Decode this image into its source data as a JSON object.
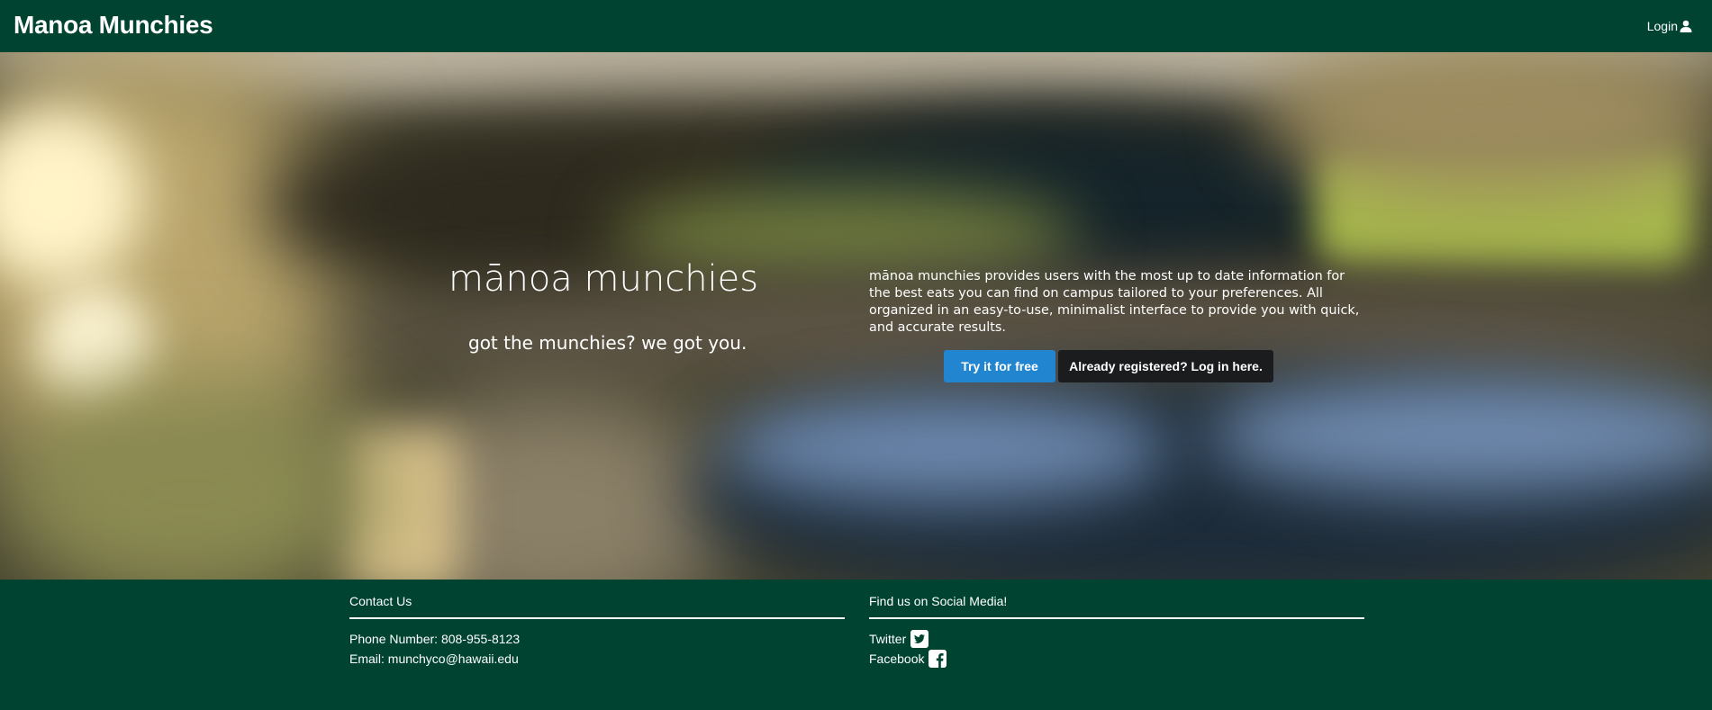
{
  "navbar": {
    "brand": "Manoa Munchies",
    "login_label": "Login"
  },
  "hero": {
    "title": "mānoa munchies",
    "subtitle": "got the munchies? we got you.",
    "description": "mānoa munchies provides users with the most up to date information for the best eats you can find on campus tailored to your preferences. All organized in an easy-to-use, minimalist interface to provide you with quick, and accurate results.",
    "try_button": "Try it for free",
    "login_button": "Already registered? Log in here.",
    "try_button_color": "#2185d0",
    "login_button_color": "#1b1c1d"
  },
  "footer": {
    "contact_heading": "Contact Us",
    "phone": "Phone Number: 808-955-8123",
    "email": "Email: munchyco@hawaii.edu",
    "social_heading": "Find us on Social Media!",
    "twitter_label": "Twitter",
    "facebook_label": "Facebook",
    "twitter_icon": "twitter-square-icon",
    "facebook_icon": "facebook-square-icon"
  },
  "colors": {
    "primary": "#004331",
    "accent": "#2185d0"
  }
}
